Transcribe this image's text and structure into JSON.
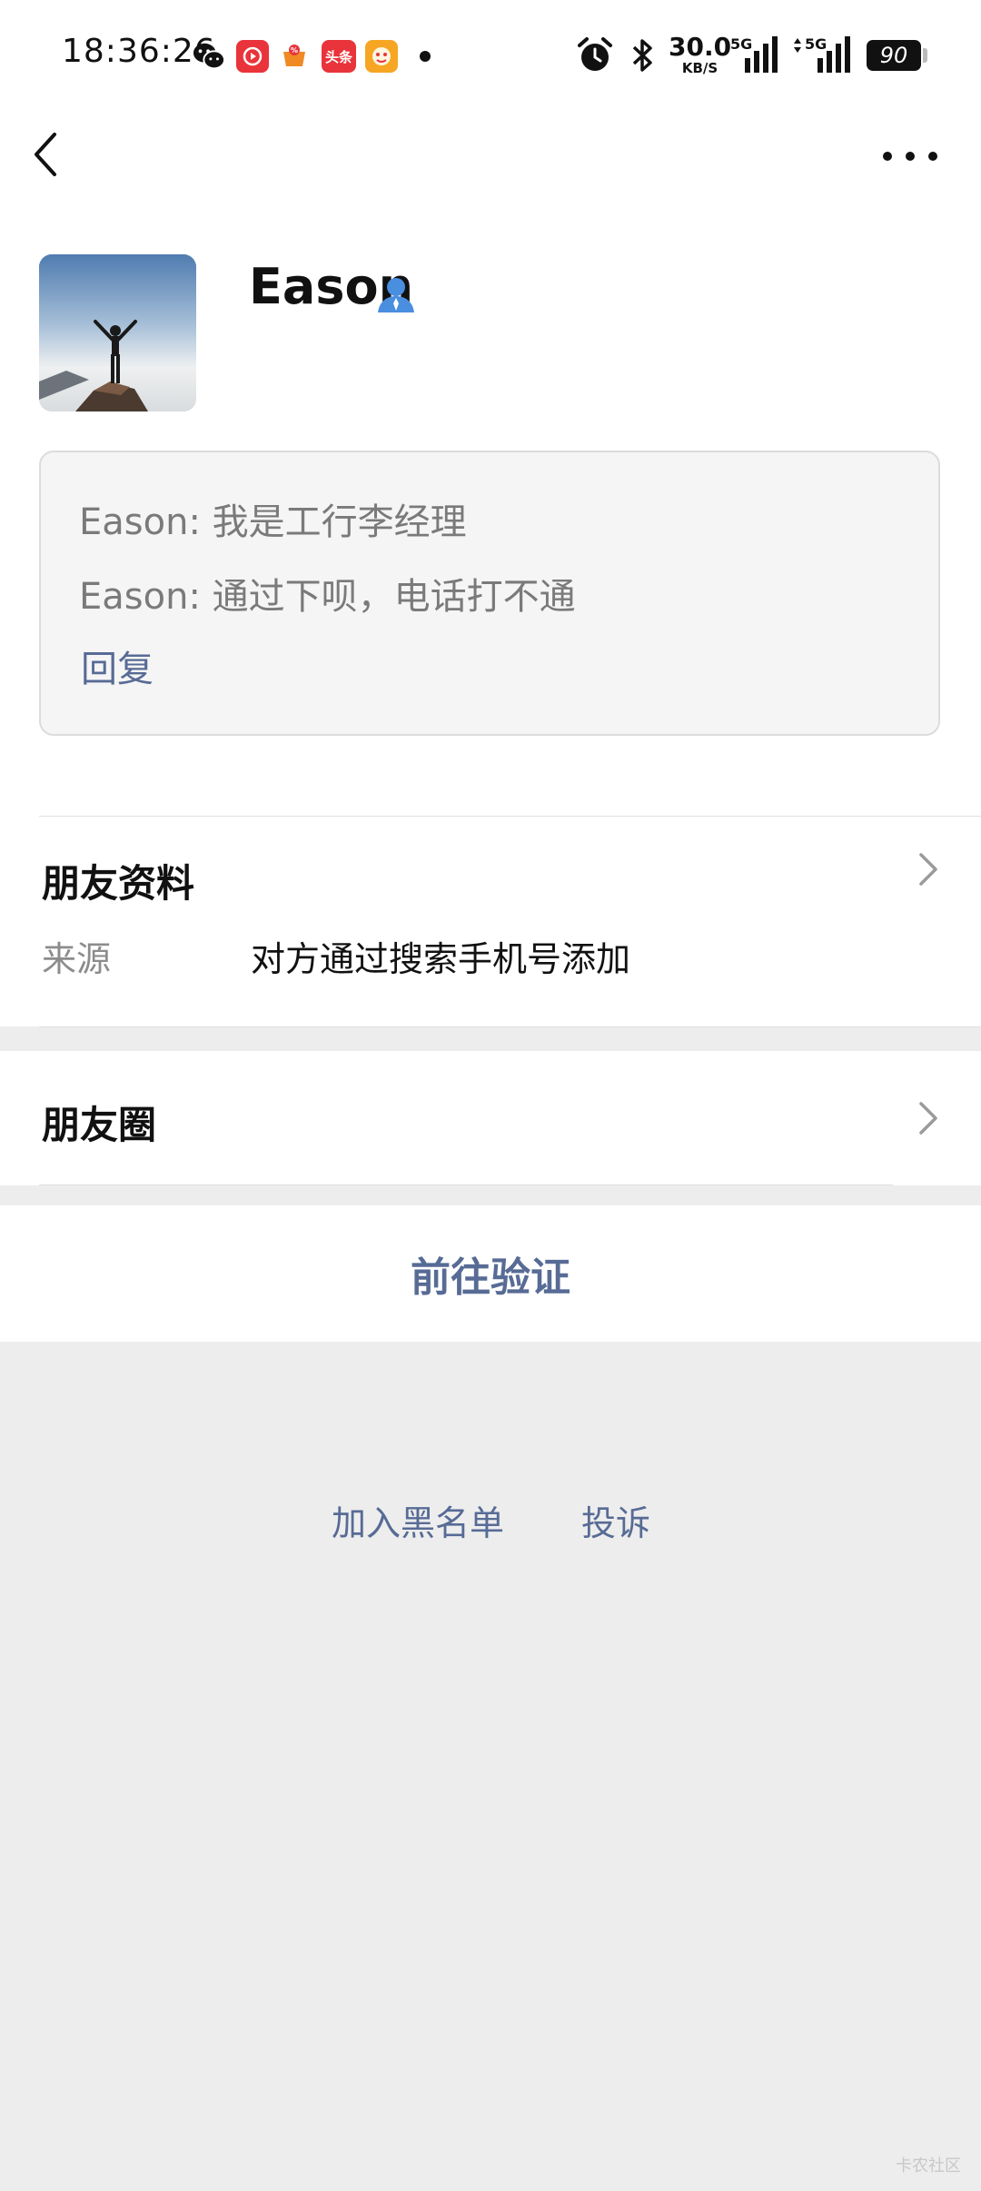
{
  "status_bar": {
    "time": "18:36:26",
    "net_speed_value": "30.0",
    "net_speed_unit": "KB/S",
    "signal1_label": "5G",
    "signal2_label": "5G",
    "battery": "90",
    "app_icons": [
      "wechat-icon",
      "video-app-icon",
      "shopping-app-icon",
      "toutiao-icon",
      "game-app-icon"
    ],
    "toutiao_label": "头条"
  },
  "profile": {
    "name": "Eason"
  },
  "message_box": {
    "lines": [
      "Eason: 我是工行李经理",
      "Eason: 通过下呗，电话打不通"
    ],
    "reply_label": "回复"
  },
  "friend_info": {
    "title": "朋友资料",
    "source_label": "来源",
    "source_value": "对方通过搜索手机号添加"
  },
  "moments": {
    "title": "朋友圈"
  },
  "verify_button": "前往验证",
  "bottom_links": {
    "blacklist": "加入黑名单",
    "report": "投诉"
  },
  "watermark": "卡农社区",
  "colors": {
    "link_blue": "#576b95",
    "background_grey": "#ededed",
    "identity_icon_blue": "#4a8ee0"
  }
}
